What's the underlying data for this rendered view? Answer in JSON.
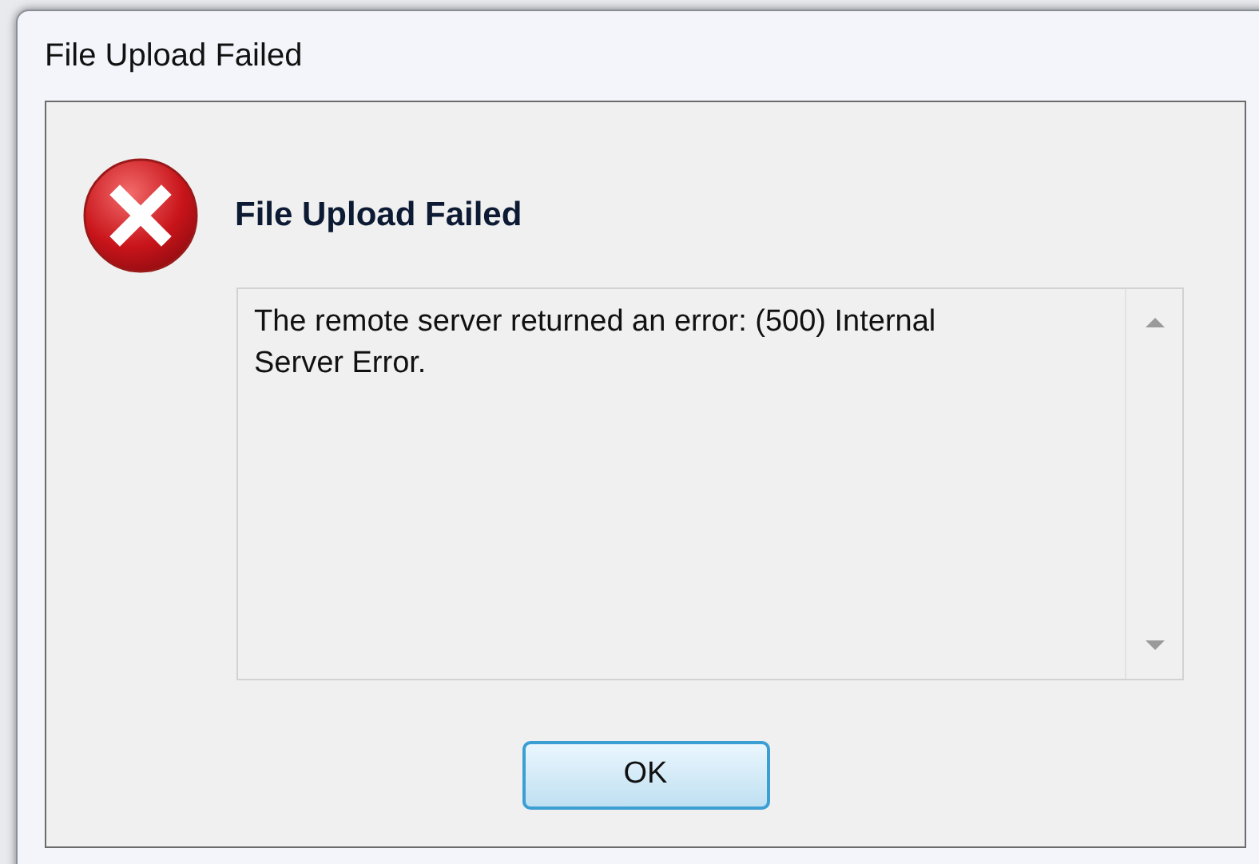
{
  "window": {
    "title": "File Upload Failed"
  },
  "heading": "File Upload Failed",
  "message": {
    "text": "The remote server returned an error: (500) Internal Server Error."
  },
  "buttons": [
    {
      "label": "OK",
      "focused": true
    }
  ]
}
